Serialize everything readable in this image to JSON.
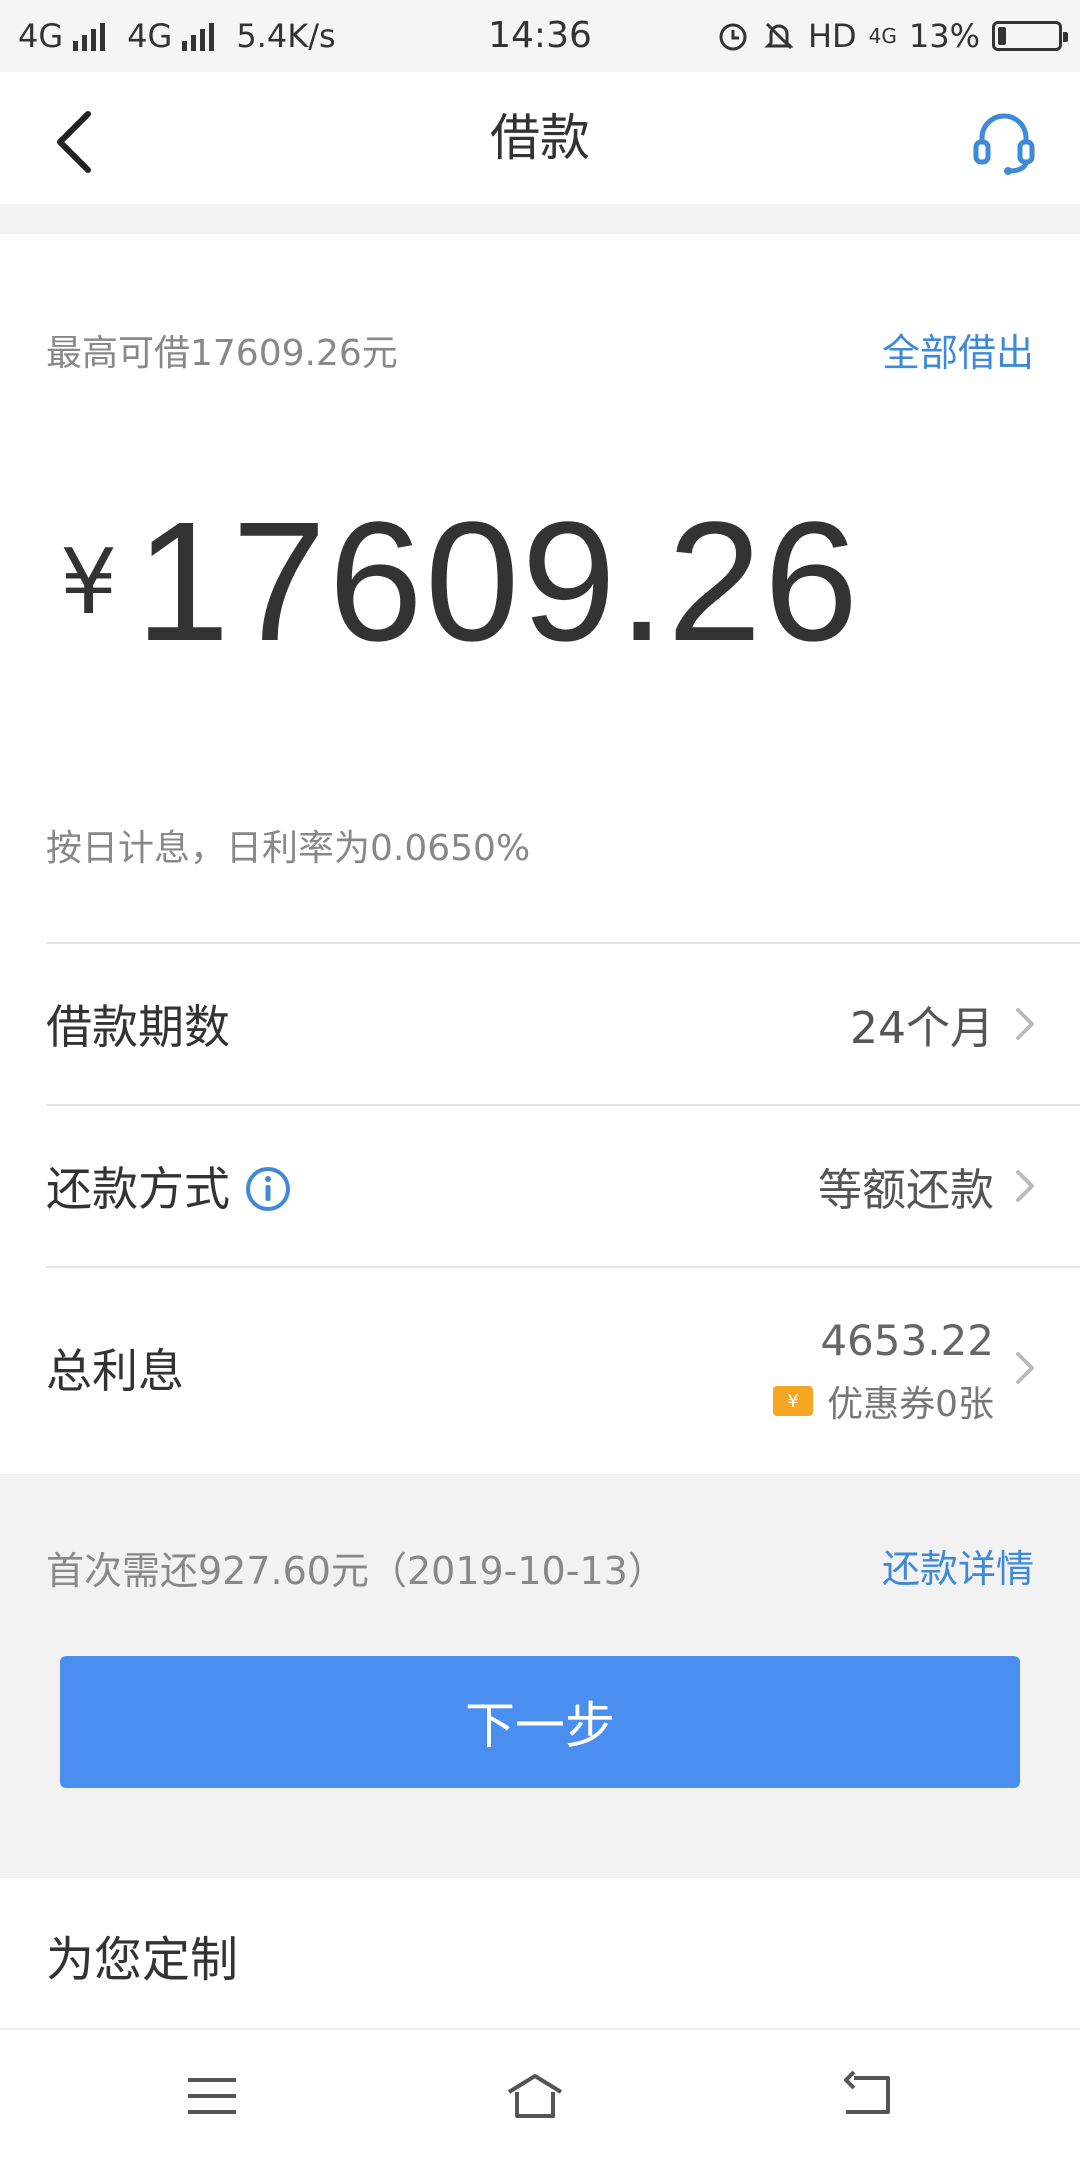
{
  "status_bar": {
    "net1": "4G",
    "net2": "4G",
    "speed": "5.4K/s",
    "time": "14:36",
    "hd_label": "HD",
    "net3": "4G",
    "battery_text": "13%",
    "battery_level": 0.13
  },
  "nav": {
    "title": "借款",
    "back_icon": "chevron-left-icon",
    "service_icon": "headset-icon"
  },
  "loan": {
    "max_label": "最高可借17609.26元",
    "borrow_all_label": "全部借出",
    "currency_symbol": "¥",
    "amount": "17609.26",
    "rate_text": "按日计息，日利率为0.0650%"
  },
  "rows": {
    "term": {
      "label": "借款期数",
      "value": "24个月"
    },
    "method": {
      "label": "还款方式",
      "value": "等额还款"
    },
    "interest": {
      "label": "总利息",
      "value": "4653.22",
      "coupon_label": "优惠券0张",
      "coupon_icon_text": "¥"
    }
  },
  "footer": {
    "first_payment": "首次需还927.60元（2019-10-13）",
    "detail_link": "还款详情",
    "next_button": "下一步",
    "custom_title": "为您定制"
  },
  "colors": {
    "accent": "#3e89d8",
    "button": "#4a8ff0",
    "coupon": "#f5a623"
  }
}
